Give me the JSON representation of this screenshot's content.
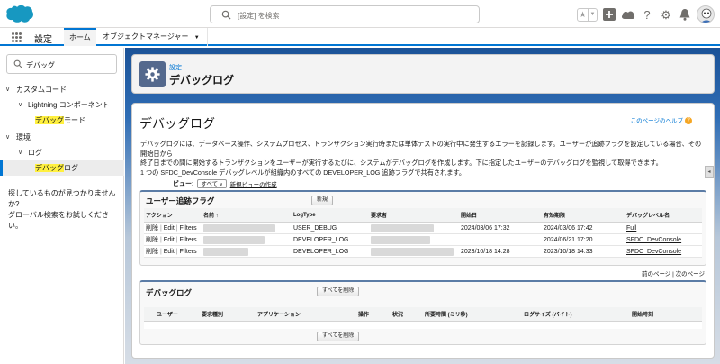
{
  "header": {
    "search_placeholder": "[設定] を検索",
    "colors": {
      "brand": "#0176d3",
      "cloud": "#1798c1"
    },
    "icons": [
      "search-icon",
      "star-icon",
      "add-icon",
      "cloud-icon",
      "help-icon",
      "gear-icon",
      "bell-icon",
      "avatar"
    ]
  },
  "nav": {
    "app_name": "設定",
    "tabs": [
      {
        "label": "ホーム",
        "active": true
      },
      {
        "label": "オブジェクトマネージャー"
      }
    ]
  },
  "sidebar": {
    "quickfind_value": "デバッグ",
    "tree": {
      "custom_code": "カスタムコード",
      "lightning_components": "Lightning コンポーネント",
      "debug_mode_hl": "デバッグ",
      "debug_mode_rest": "モード",
      "environments": "環境",
      "logs": "ログ",
      "debug_logs_hl": "デバッグ",
      "debug_logs_rest": "ログ"
    },
    "help_line1": "探しているものが見つかりませんか?",
    "help_line2": "グローバル検索をお試しください。"
  },
  "page_header": {
    "kicker": "設定",
    "title": "デバッグログ"
  },
  "main": {
    "title": "デバッグログ",
    "help_link": "このページのヘルプ",
    "description": [
      "デバッグログには、データベース操作、システムプロセス、トランザクション実行時または単体テストの実行中に発生するエラーを記録します。ユーザーが追跡フラグを設定している場合、その開始日から",
      "終了日までの間に開始するトランザクションをユーザーが実行するたびに、システムがデバッグログを作成します。下に指定したユーザーのデバッグログを監視して取得できます。",
      "1 つの SFDC_DevConsole デバッグレベルが組織内のすべての DEVELOPER_LOG 追跡フラグで共有されます。"
    ],
    "view_label": "ビュー:",
    "view_value": "すべて",
    "new_view_link": "新規ビューの作成"
  },
  "trace_flags": {
    "title": "ユーザー追跡フラグ",
    "new_button": "新規",
    "columns": [
      "アクション",
      "名前 ↑",
      "LogType",
      "要求者",
      "開始日",
      "有効期限",
      "デバッグレベル名"
    ],
    "action_delete": "削除",
    "action_edit": "Edit",
    "action_filters": "Filters",
    "rows": [
      {
        "log_type": "USER_DEBUG",
        "start": "2024/03/06 17:32",
        "expiry": "2024/03/06 17:42",
        "level": "Full"
      },
      {
        "log_type": "DEVELOPER_LOG",
        "start": "",
        "expiry": "2024/06/21 17:20",
        "level": "SFDC_DevConsole"
      },
      {
        "log_type": "DEVELOPER_LOG",
        "start": "2023/10/18 14:28",
        "expiry": "2023/10/18 14:33",
        "level": "SFDC_DevConsole"
      }
    ]
  },
  "pager": {
    "prev": "前のページ",
    "next": "次のページ"
  },
  "debug_logs": {
    "title": "デバッグログ",
    "delete_all_button": "すべてを削除",
    "columns": [
      "ユーザー",
      "要求種別",
      "アプリケーション",
      "操作",
      "状況",
      "所要時間 (ミリ秒)",
      "ログサイズ (バイト)",
      "開始時刻"
    ]
  }
}
